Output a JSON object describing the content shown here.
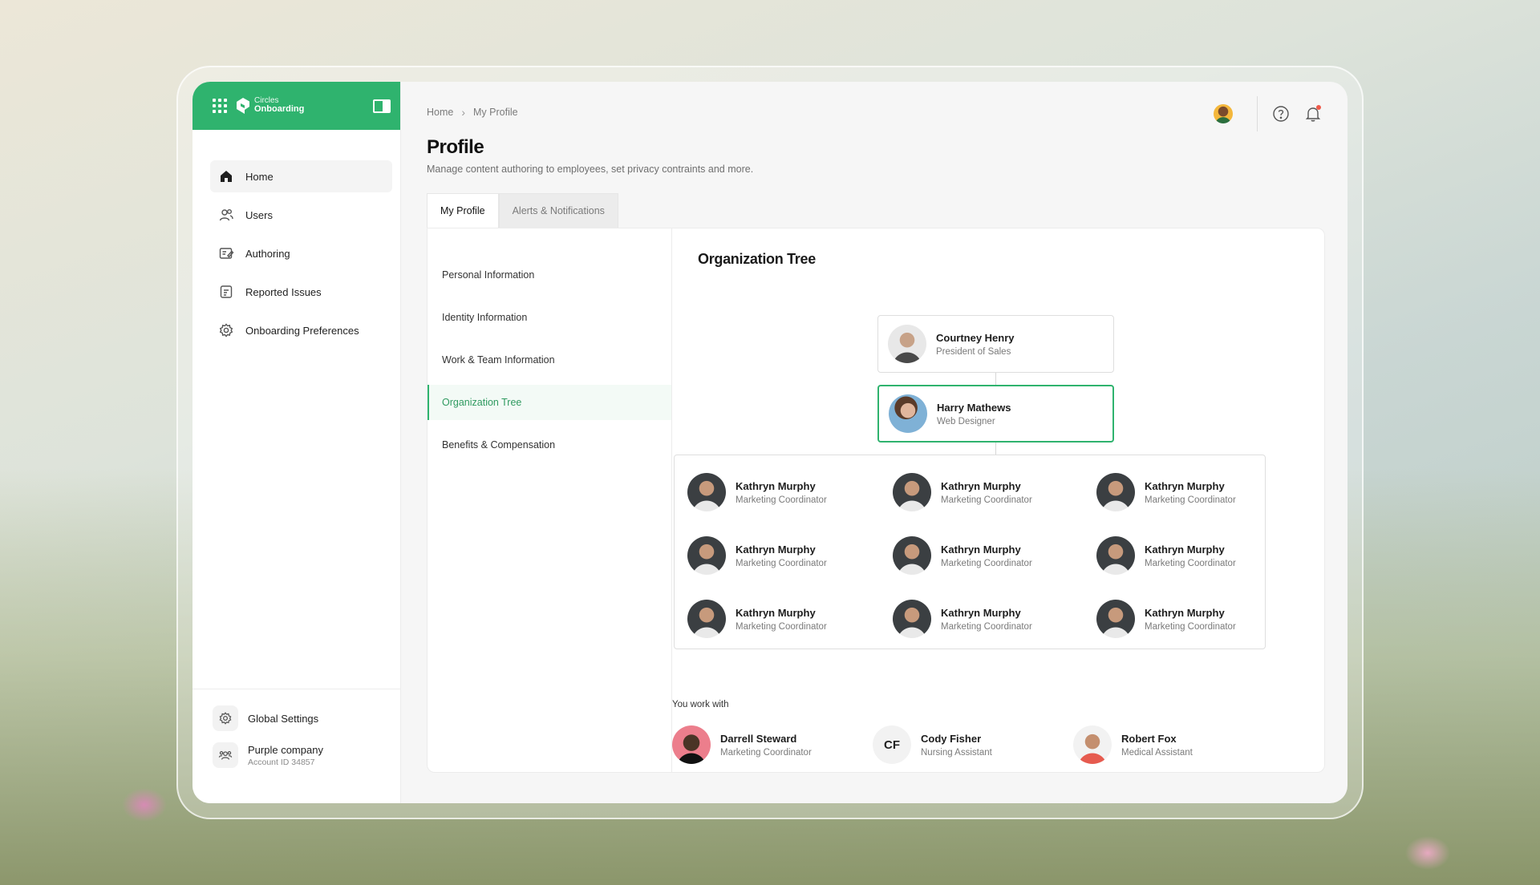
{
  "brand": {
    "small": "Circles",
    "big": "Onboarding"
  },
  "sidebar": {
    "items": [
      {
        "label": "Home",
        "icon": "home-icon"
      },
      {
        "label": "Users",
        "icon": "users-icon"
      },
      {
        "label": "Authoring",
        "icon": "authoring-icon"
      },
      {
        "label": "Reported Issues",
        "icon": "report-icon"
      },
      {
        "label": "Onboarding Preferences",
        "icon": "settings-icon"
      }
    ],
    "global_settings": "Global Settings",
    "company": {
      "name": "Purple company",
      "account": "Account ID 34857"
    }
  },
  "breadcrumb": {
    "home": "Home",
    "current": "My Profile"
  },
  "page": {
    "title": "Profile",
    "subtitle": "Manage content authoring to employees, set privacy contraints and more."
  },
  "tabs": [
    {
      "label": "My Profile"
    },
    {
      "label": "Alerts & Notifications"
    }
  ],
  "subnav": [
    {
      "label": "Personal Information"
    },
    {
      "label": "Identity Information"
    },
    {
      "label": "Work & Team Information"
    },
    {
      "label": "Organization Tree"
    },
    {
      "label": "Benefits & Compensation"
    }
  ],
  "org": {
    "title": "Organization Tree",
    "leader": {
      "name": "Courtney Henry",
      "role": "President of Sales"
    },
    "me": {
      "name": "Harry Mathews",
      "role": "Web Designer"
    },
    "team": [
      {
        "name": "Kathryn Murphy",
        "role": "Marketing Coordinator"
      },
      {
        "name": "Kathryn Murphy",
        "role": "Marketing Coordinator"
      },
      {
        "name": "Kathryn Murphy",
        "role": "Marketing Coordinator"
      },
      {
        "name": "Kathryn Murphy",
        "role": "Marketing Coordinator"
      },
      {
        "name": "Kathryn Murphy",
        "role": "Marketing Coordinator"
      },
      {
        "name": "Kathryn Murphy",
        "role": "Marketing Coordinator"
      },
      {
        "name": "Kathryn Murphy",
        "role": "Marketing Coordinator"
      },
      {
        "name": "Kathryn Murphy",
        "role": "Marketing Coordinator"
      },
      {
        "name": "Kathryn Murphy",
        "role": "Marketing Coordinator"
      }
    ],
    "works_with_label": "You work with",
    "works_with": [
      {
        "name": "Darrell Steward",
        "role": "Marketing Coordinator"
      },
      {
        "initials": "CF",
        "name": "Cody Fisher",
        "role": "Nursing Assistant"
      },
      {
        "name": "Robert Fox",
        "role": "Medical Assistant"
      }
    ]
  },
  "colors": {
    "accent": "#2fb36e",
    "notification": "#ef5a4a"
  }
}
